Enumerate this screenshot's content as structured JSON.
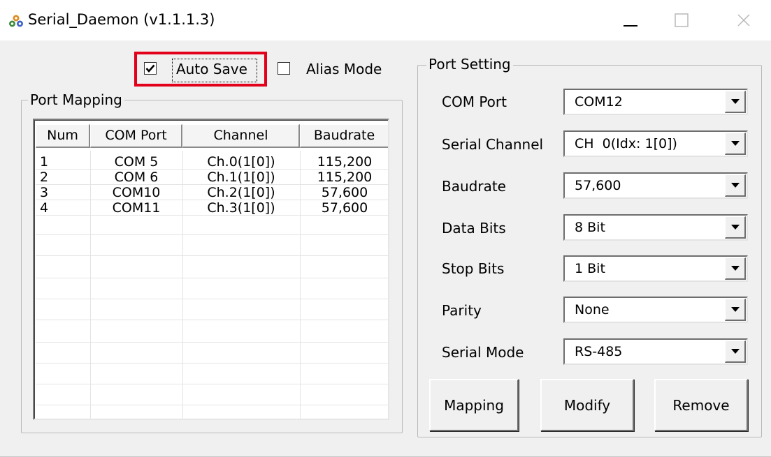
{
  "window": {
    "title": "Serial_Daemon (v1.1.1.3)",
    "icon": "app-icon",
    "controls": [
      "minimize-icon",
      "maximize-icon",
      "close-icon"
    ]
  },
  "options": {
    "auto_save_label": "Auto Save",
    "auto_save_checked": true,
    "alias_mode_label": "Alias Mode",
    "alias_mode_checked": false,
    "highlight_color": "#e3001b"
  },
  "port_mapping": {
    "title": "Port Mapping",
    "columns": [
      "Num",
      "COM Port",
      "Channel",
      "Baudrate"
    ],
    "rows": [
      [
        "1",
        "COM 5",
        "Ch.0(1[0])",
        "115,200"
      ],
      [
        "2",
        "COM 6",
        "Ch.1(1[0])",
        "115,200"
      ],
      [
        "3",
        "COM10",
        "Ch.2(1[0])",
        "57,600"
      ],
      [
        "4",
        "COM11",
        "Ch.3(1[0])",
        "57,600"
      ]
    ]
  },
  "port_setting": {
    "title": "Port Setting",
    "fields": [
      {
        "label": "COM Port",
        "value": "COM12"
      },
      {
        "label": "Serial Channel",
        "value": "CH  0(Idx: 1[0])"
      },
      {
        "label": "Baudrate",
        "value": "57,600"
      },
      {
        "label": "Data Bits",
        "value": "8 Bit"
      },
      {
        "label": "Stop Bits",
        "value": "1 Bit"
      },
      {
        "label": "Parity",
        "value": "None"
      },
      {
        "label": "Serial Mode",
        "value": "RS-485"
      }
    ],
    "buttons": {
      "mapping": "Mapping",
      "modify": "Modify",
      "remove": "Remove"
    }
  }
}
